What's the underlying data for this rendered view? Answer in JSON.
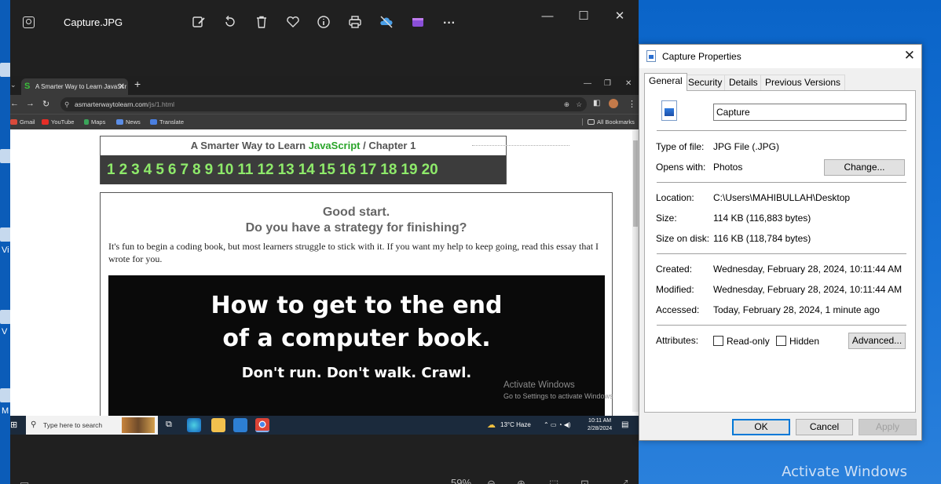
{
  "photos": {
    "file_name": "Capture.JPG",
    "toolbar_icons": [
      "edit-image-icon",
      "rotate-icon",
      "delete-icon",
      "favorite-icon",
      "info-icon",
      "print-icon",
      "onedrive-icon",
      "video-editor-icon",
      "more-icon"
    ],
    "more_label": "···",
    "zoom_text": "59%",
    "minimize": "—",
    "maximize": "☐",
    "close": "✕"
  },
  "browser": {
    "tab_title": "A Smarter Way to Learn JavaScr",
    "tab_favicon": "S",
    "url_host": "asmarterwaytolearn.com",
    "url_path": "/js/1.html",
    "bookmarks": [
      "Gmail",
      "YouTube",
      "Maps",
      "News",
      "Translate"
    ],
    "all_bookmarks": "All Bookmarks"
  },
  "webpage": {
    "header_prefix": "A Smarter Way to Learn",
    "header_js": "JavaScript",
    "header_suffix": "/  Chapter 1",
    "chapter_numbers": [
      "1",
      "2",
      "3",
      "4",
      "5",
      "6",
      "7",
      "8",
      "9",
      "10",
      "11",
      "12",
      "13",
      "14",
      "15",
      "16",
      "17",
      "18",
      "19",
      "20"
    ],
    "heading1": "Good start.",
    "heading2": "Do you have a strategy for finishing?",
    "paragraph": "It's fun to begin a coding book, but most learners struggle to stick with it. If you want my help to keep going, read this essay that I wrote for you.",
    "banner_line1": "How to get to the end",
    "banner_line2": "of a computer book.",
    "banner_line3": "Don't run. Don't walk. Crawl.",
    "activate_title": "Activate Windows",
    "activate_sub": "Go to Settings to activate Windows"
  },
  "inner_taskbar": {
    "search_placeholder": "Type here to search",
    "weather": "13°C  Haze",
    "time": "10:11 AM",
    "date": "2/28/2024"
  },
  "desktop": {
    "watermark": "Activate Windows",
    "edge_labels": [
      "Vi",
      "V",
      "M"
    ]
  },
  "dialog": {
    "title": "Capture Properties",
    "tabs": [
      "General",
      "Security",
      "Details",
      "Previous Versions"
    ],
    "active_tab": "General",
    "file_name": "Capture",
    "type_label": "Type of file:",
    "type_value": "JPG File (.JPG)",
    "opens_label": "Opens with:",
    "opens_value": "Photos",
    "change_button": "Change...",
    "location_label": "Location:",
    "location_value": "C:\\Users\\MAHIBULLAH\\Desktop",
    "size_label": "Size:",
    "size_value": "114 KB (116,883 bytes)",
    "size_disk_label": "Size on disk:",
    "size_disk_value": "116 KB (118,784 bytes)",
    "created_label": "Created:",
    "created_value": "Wednesday, February 28, 2024, 10:11:44 AM",
    "modified_label": "Modified:",
    "modified_value": "Wednesday, February 28, 2024, 10:11:44 AM",
    "accessed_label": "Accessed:",
    "accessed_value": "Today, February 28, 2024, 1 minute ago",
    "attributes_label": "Attributes:",
    "readonly_label": "Read-only",
    "hidden_label": "Hidden",
    "advanced_button": "Advanced...",
    "ok_button": "OK",
    "cancel_button": "Cancel",
    "apply_button": "Apply"
  }
}
